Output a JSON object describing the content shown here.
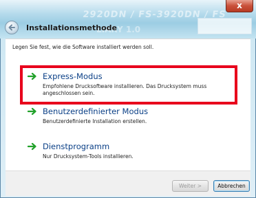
{
  "window": {
    "title": "Installationsmethode",
    "ghost_line1": "2920DN / FS-3920DN / FS",
    "ghost_line2": "LIARY 1.0",
    "close_glyph": "x"
  },
  "instruction": "Legen Sie fest, wie die Software installiert werden soll.",
  "options": [
    {
      "label": "Express-Modus",
      "description": "Empfohlene Drucksoftware installieren. Das Drucksystem muss angeschlossen sein.",
      "icon": "green-arrow-icon"
    },
    {
      "label": "Benutzerdefinierter Modus",
      "description": "Benutzerdefinierte Installation erstellen.",
      "icon": "green-arrow-icon"
    },
    {
      "label": "Dienstprogramm",
      "description": "Nur Drucksystem-Tools installieren.",
      "icon": "green-arrow-icon"
    }
  ],
  "buttons": {
    "next": "Weiter >",
    "cancel": "Abbrechen"
  },
  "colors": {
    "highlight": "#e8001c",
    "link": "#0a3f86",
    "arrow": "#21a12a"
  }
}
